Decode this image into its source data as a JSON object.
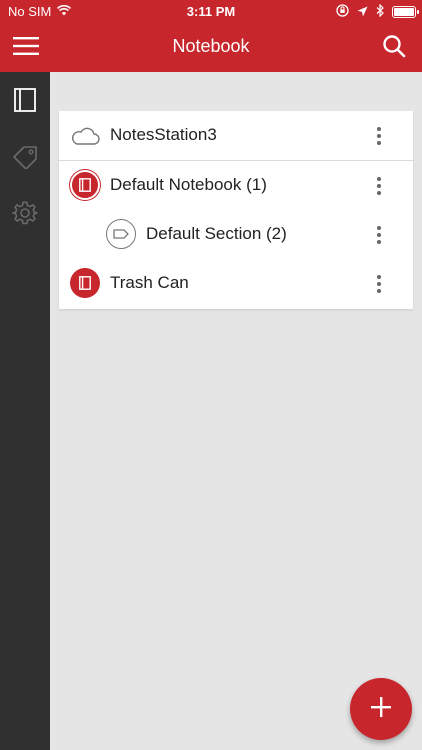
{
  "status_bar": {
    "carrier": "No SIM",
    "time": "3:11 PM"
  },
  "nav": {
    "title": "Notebook",
    "menu_icon": "hamburger-icon",
    "search_icon": "search-icon"
  },
  "sidebar": {
    "items": [
      {
        "icon": "notebook-icon",
        "active": true
      },
      {
        "icon": "tag-icon",
        "active": false
      },
      {
        "icon": "gear-icon",
        "active": false
      }
    ]
  },
  "list": {
    "items": [
      {
        "label": "NotesStation3",
        "icon": "cloud-icon",
        "level": 0
      },
      {
        "label": "Default Notebook (1)",
        "icon": "notebook-icon",
        "level": 0
      },
      {
        "label": "Default Section (2)",
        "icon": "section-icon",
        "level": 1
      },
      {
        "label": "Trash Can",
        "icon": "trash-notebook-icon",
        "level": 0
      }
    ]
  },
  "fab": {
    "icon": "plus-icon"
  },
  "colors": {
    "brand": "#c7262c",
    "sidebar": "#303030",
    "background": "#e5e5e5"
  }
}
